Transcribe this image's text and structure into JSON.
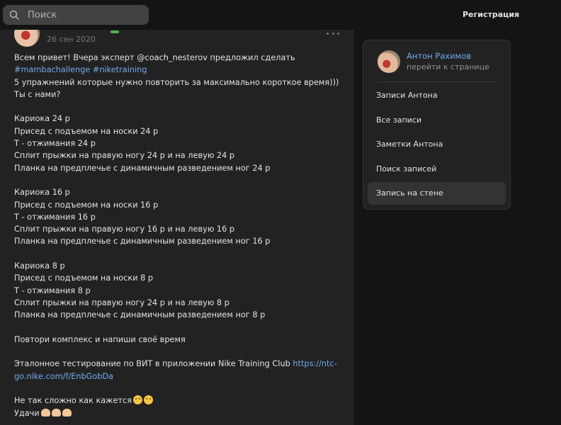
{
  "header": {
    "search_placeholder": "Поиск",
    "register_label": "Регистрация"
  },
  "post": {
    "date": "26 сен 2020",
    "lines": [
      [
        "Всем привет! Вчера эксперт @coach_nesterov предложил сделать"
      ],
      [
        "#mambachallenge #niketraining"
      ],
      [
        "5 упражнений которые нужно повторить за максимально короткое время)))"
      ],
      [
        "Ты с нами?"
      ],
      [
        ""
      ],
      [
        "Кариока 24 р"
      ],
      [
        "Присед с подъемом на носки 24 р"
      ],
      [
        "Т - отжимания 24 р"
      ],
      [
        "Сплит прыжки на правую ногу 24 р и на левую 24 р"
      ],
      [
        "Планка на предплечье с динамичным разведением ног 24 р"
      ],
      [
        ""
      ],
      [
        "Кариока 16 р"
      ],
      [
        "Присед с подъемом на носки 16 р"
      ],
      [
        "Т - отжимания 16 р"
      ],
      [
        "Сплит прыжки на правую ногу 16 р и на левую 16 р"
      ],
      [
        "Планка на предплечье с динамичным разведением ног 16 р"
      ],
      [
        ""
      ],
      [
        "Кариока 8 р"
      ],
      [
        "Присед с подъемом на носки 8 р"
      ],
      [
        "Т - отжимания 8 р"
      ],
      [
        "Сплит прыжки на правую ногу 24 р и на левую 8 р"
      ],
      [
        "Планка на предплечье с динамичным разведением ног 8 р"
      ],
      [
        ""
      ],
      [
        "Повтори комплекс и напиши своё время"
      ],
      [
        ""
      ],
      [
        "Эталонное тестирование по ВИТ в приложении Nike Training Club ",
        "https://ntc-"
      ],
      [
        "go.nike.com/f/EnbGobDa"
      ],
      [
        ""
      ],
      [
        "Не так сложно как кажется"
      ],
      [
        "Удачи"
      ]
    ],
    "hashtags_line_index": 1,
    "link_part_line_indices": [
      25,
      26
    ]
  },
  "sidebar": {
    "profile_name": "Антон Рахимов",
    "profile_link": "перейти к странице",
    "menu": [
      {
        "label": "Записи Антона",
        "active": false
      },
      {
        "label": "Все записи",
        "active": false
      },
      {
        "label": "Заметки Антона",
        "active": false
      },
      {
        "label": "Поиск записей",
        "active": false
      },
      {
        "label": "Запись на стене",
        "active": true
      }
    ]
  },
  "icons": {
    "search": "search-icon",
    "more": "more-dots-icon",
    "emoji": "emoji-icon",
    "arm": "flexed-biceps-icon"
  },
  "colors": {
    "link": "#71aaeb",
    "background": "#141414",
    "panel": "#222222",
    "active_menu": "#333333"
  }
}
